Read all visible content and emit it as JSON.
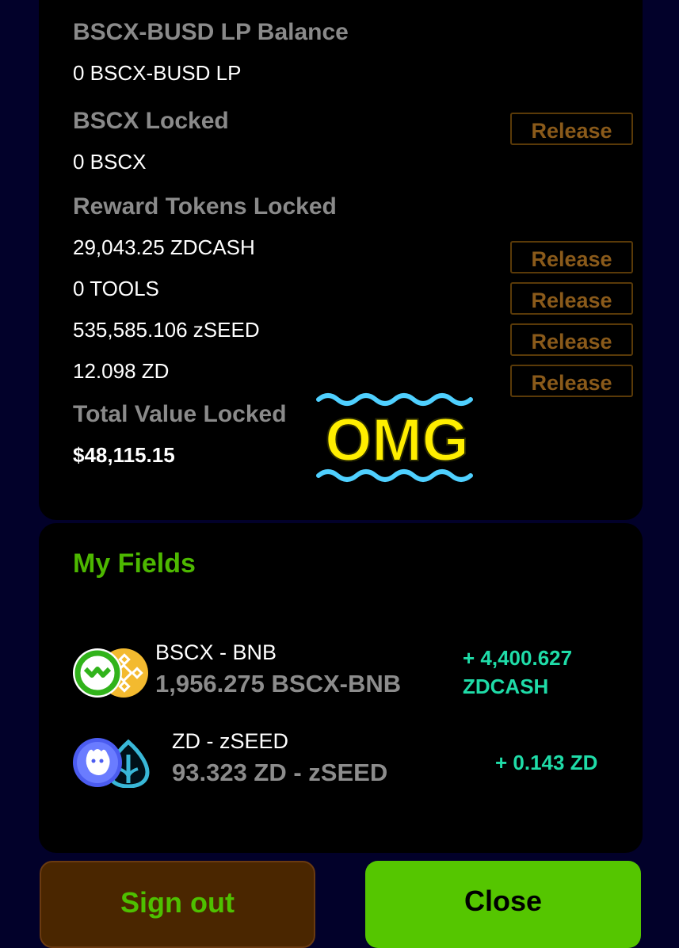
{
  "colors": {
    "background": "#02012a",
    "card": "#000000",
    "label_gray": "#8a8a8a",
    "accent_green": "#55c600",
    "reward_teal": "#1fdca8",
    "release_brown": "#8a5a1a",
    "omg_yellow": "#ffee00",
    "omg_wave": "#4fd0ff"
  },
  "staking": {
    "lp_balance_label": "BSCX-BUSD LP Balance",
    "lp_balance_value": "0 BSCX-BUSD LP",
    "bscx_locked_label": "BSCX Locked",
    "bscx_locked_value": "0 BSCX",
    "reward_tokens_label": "Reward Tokens Locked",
    "reward_tokens": [
      {
        "value": "29,043.25 ZDCASH"
      },
      {
        "value": "0 TOOLS"
      },
      {
        "value": "535,585.106 zSEED"
      },
      {
        "value": "12.098 ZD"
      }
    ],
    "tvl_label": "Total Value Locked",
    "tvl_value": "$48,115.15",
    "release_label": "Release"
  },
  "sticker": {
    "text": "OMG"
  },
  "fields": {
    "title": "My Fields",
    "items": [
      {
        "pair": "BSCX - BNB",
        "amount": "1,956.275 BSCX-BNB",
        "reward_line1": "+ 4,400.627",
        "reward_line2": "ZDCASH",
        "icons": [
          "bscx-token-icon",
          "bnb-token-icon"
        ]
      },
      {
        "pair": "ZD - zSEED",
        "amount": "93.323 ZD - zSEED",
        "reward_line1": "+ 0.143 ZD",
        "icons": [
          "zd-token-icon",
          "zseed-token-icon"
        ]
      }
    ]
  },
  "actions": {
    "sign_out": "Sign out",
    "close": "Close"
  }
}
